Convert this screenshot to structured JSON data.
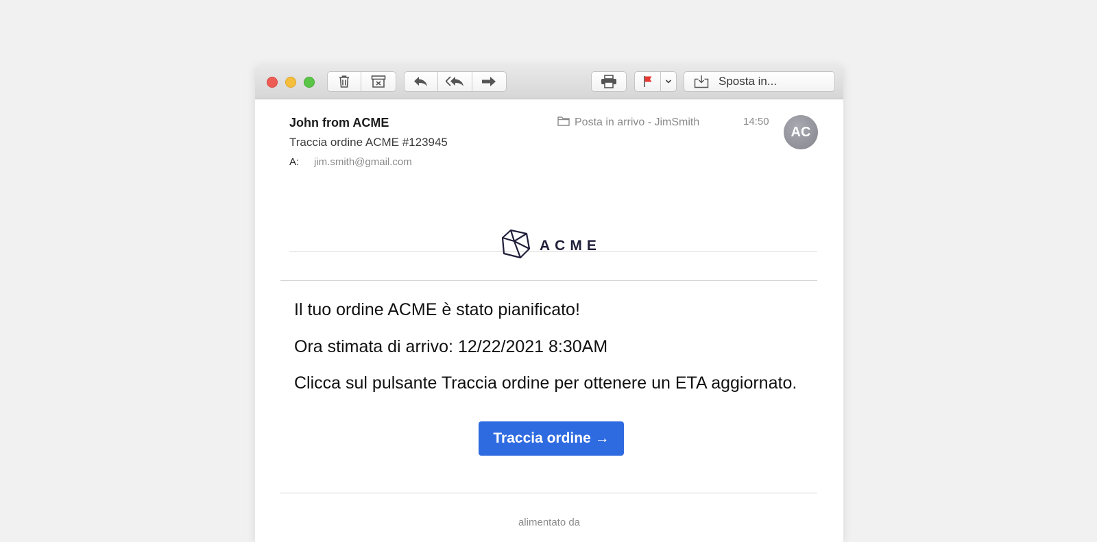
{
  "toolbar": {
    "delete_icon": "trash-icon",
    "archive_icon": "archive-icon",
    "reply_icon": "reply-icon",
    "reply_all_icon": "reply-all-icon",
    "forward_icon": "forward-icon",
    "print_icon": "print-icon",
    "flag_icon": "flag-icon",
    "flag_color": "#e53935",
    "move_icon": "move-to-icon",
    "move_label": "Sposta in..."
  },
  "message": {
    "sender": "John from ACME",
    "subject": "Traccia ordine ACME #123945",
    "to_label": "A:",
    "to_value": "jim.smith@gmail.com",
    "mailbox": "Posta in arrivo - JimSmith",
    "time": "14:50",
    "avatar_initials": "AC"
  },
  "email_body": {
    "logo_text": "ACME",
    "line1": "Il tuo ordine ACME è stato pianificato!",
    "line2": "Ora stimata di arrivo: 12/22/2021 8:30AM",
    "line3": "Clicca sul pulsante Traccia ordine per ottenere un ETA aggiornato.",
    "button_label": "Traccia ordine →",
    "button_color": "#2f6be0",
    "footer": "alimentato da"
  }
}
